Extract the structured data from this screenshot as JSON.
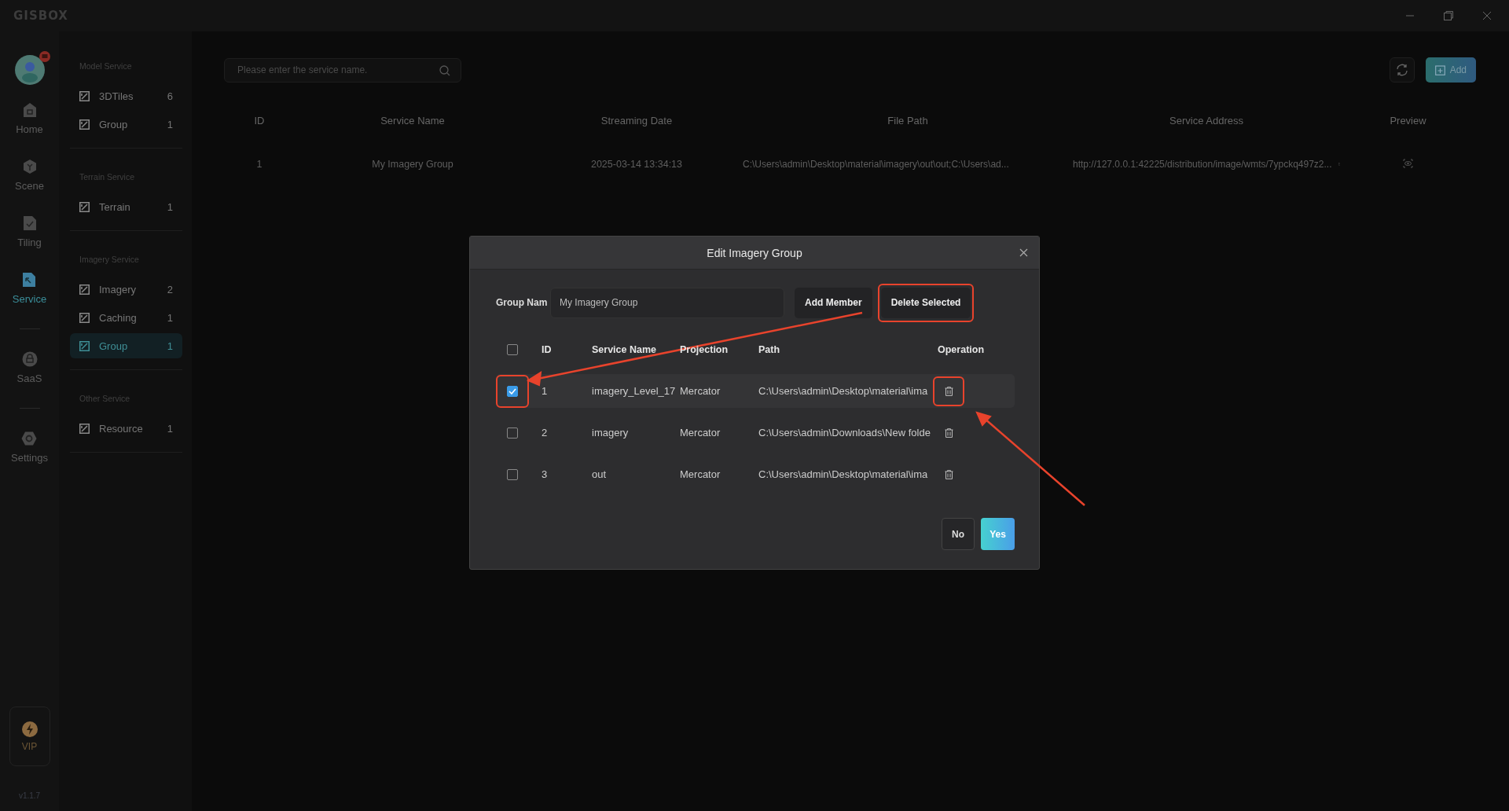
{
  "app": {
    "logo": "GISBOX"
  },
  "nav": [
    {
      "label": "Home",
      "selected": false
    },
    {
      "label": "Scene",
      "selected": false
    },
    {
      "label": "Tiling",
      "selected": false
    },
    {
      "label": "Service",
      "selected": true
    },
    {
      "label": "SaaS",
      "selected": false
    },
    {
      "label": "Settings",
      "selected": false
    }
  ],
  "vip": {
    "label": "VIP"
  },
  "version": "v1.1.7",
  "sidebar": {
    "sections": [
      {
        "title": "Model Service",
        "items": [
          {
            "label": "3DTiles",
            "count": "6",
            "selected": false
          },
          {
            "label": "Group",
            "count": "1",
            "selected": false
          }
        ]
      },
      {
        "title": "Terrain Service",
        "items": [
          {
            "label": "Terrain",
            "count": "1",
            "selected": false
          }
        ]
      },
      {
        "title": "Imagery Service",
        "items": [
          {
            "label": "Imagery",
            "count": "2",
            "selected": false
          },
          {
            "label": "Caching",
            "count": "1",
            "selected": false
          },
          {
            "label": "Group",
            "count": "1",
            "selected": true
          }
        ]
      },
      {
        "title": "Other Service",
        "items": [
          {
            "label": "Resource",
            "count": "1",
            "selected": false
          }
        ]
      }
    ]
  },
  "search": {
    "placeholder": "Please enter the service name."
  },
  "toolbar": {
    "add": "Add"
  },
  "table": {
    "columns": [
      "ID",
      "Service Name",
      "Streaming Date",
      "File Path",
      "Service Address",
      "Preview"
    ],
    "rows": [
      {
        "id": "1",
        "name": "My Imagery Group",
        "date": "2025-03-14 13:34:13",
        "path": "C:\\Users\\admin\\Desktop\\material\\imagery\\out\\out;C:\\Users\\ad...",
        "address": "http://127.0.0.1:42225/distribution/image/wmts/7ypckq497z2..."
      }
    ]
  },
  "dialog": {
    "title": "Edit Imagery Group",
    "group_label": "Group Nam",
    "group_value": "My Imagery Group",
    "add_member": "Add Member",
    "delete_selected": "Delete Selected",
    "select_all_checked": false,
    "columns": [
      "ID",
      "Service Name",
      "Projection",
      "Path",
      "Operation"
    ],
    "rows": [
      {
        "checked": true,
        "id": "1",
        "name": "imagery_Level_17",
        "projection": "Mercator",
        "path": "C:\\Users\\admin\\Desktop\\material\\ima"
      },
      {
        "checked": false,
        "id": "2",
        "name": "imagery",
        "projection": "Mercator",
        "path": "C:\\Users\\admin\\Downloads\\New folde"
      },
      {
        "checked": false,
        "id": "3",
        "name": "out",
        "projection": "Mercator",
        "path": "C:\\Users\\admin\\Desktop\\material\\ima"
      }
    ],
    "buttons": [
      "No",
      "Yes"
    ]
  }
}
